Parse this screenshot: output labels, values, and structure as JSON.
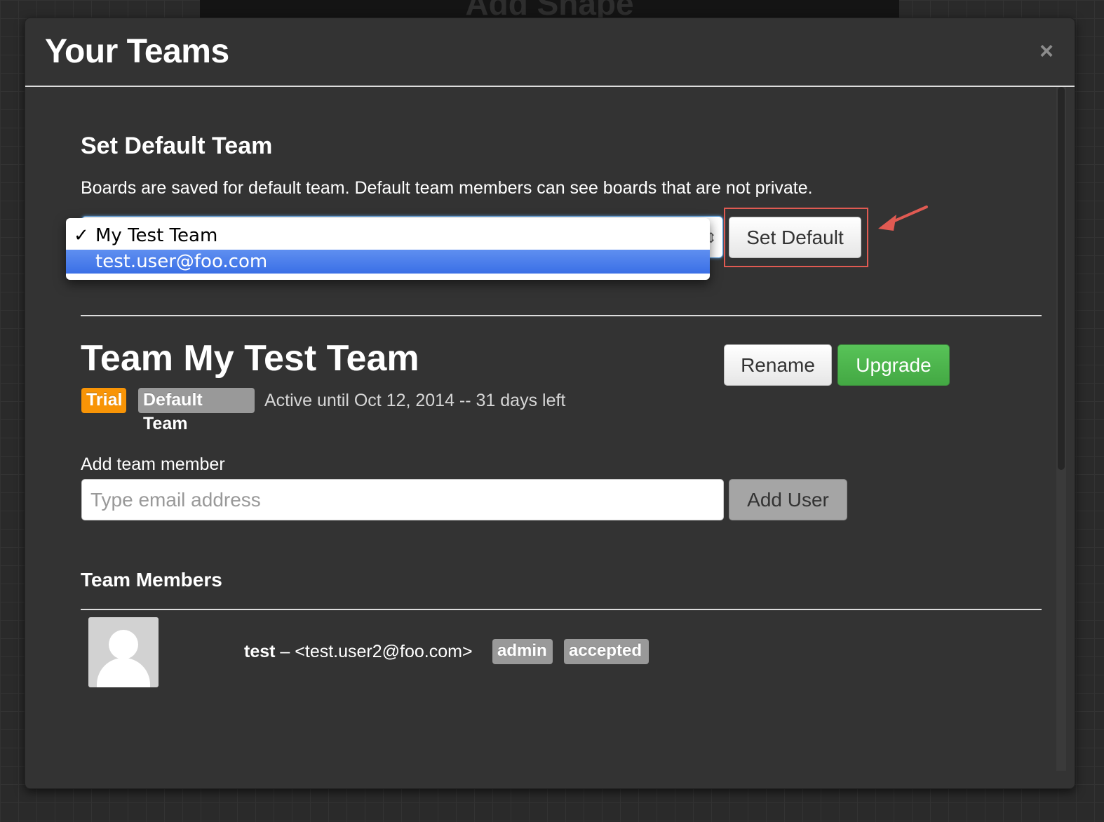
{
  "background": {
    "header_text": "Add Shape"
  },
  "modal": {
    "title": "Your Teams",
    "close_symbol": "×"
  },
  "default_team": {
    "heading": "Set Default Team",
    "description": "Boards are saved for default team. Default team members can see boards that are not private.",
    "options": [
      {
        "label": "My Test Team",
        "checked": true
      },
      {
        "label": "test.user@foo.com",
        "highlighted": true
      }
    ],
    "check_mark": "✓",
    "set_default_label": "Set Default"
  },
  "team": {
    "title": "Team My Test Team",
    "rename_label": "Rename",
    "upgrade_label": "Upgrade",
    "badges": {
      "trial": "Trial",
      "default": "Default Team"
    },
    "status": "Active until Oct 12, 2014 -- 31 days left"
  },
  "add_member": {
    "label": "Add team member",
    "placeholder": "Type email address",
    "value": "",
    "button_label": "Add User"
  },
  "members": {
    "heading": "Team Members",
    "list": [
      {
        "name": "test",
        "separator": "–",
        "email": "<test.user2@foo.com>",
        "role": "admin",
        "status": "accepted"
      }
    ]
  },
  "colors": {
    "trial_badge": "#f89406",
    "default_badge": "#999999",
    "upgrade_button": "#4cae4c",
    "highlight_red": "#e05a52",
    "selection_blue": "#3a6fe6"
  }
}
